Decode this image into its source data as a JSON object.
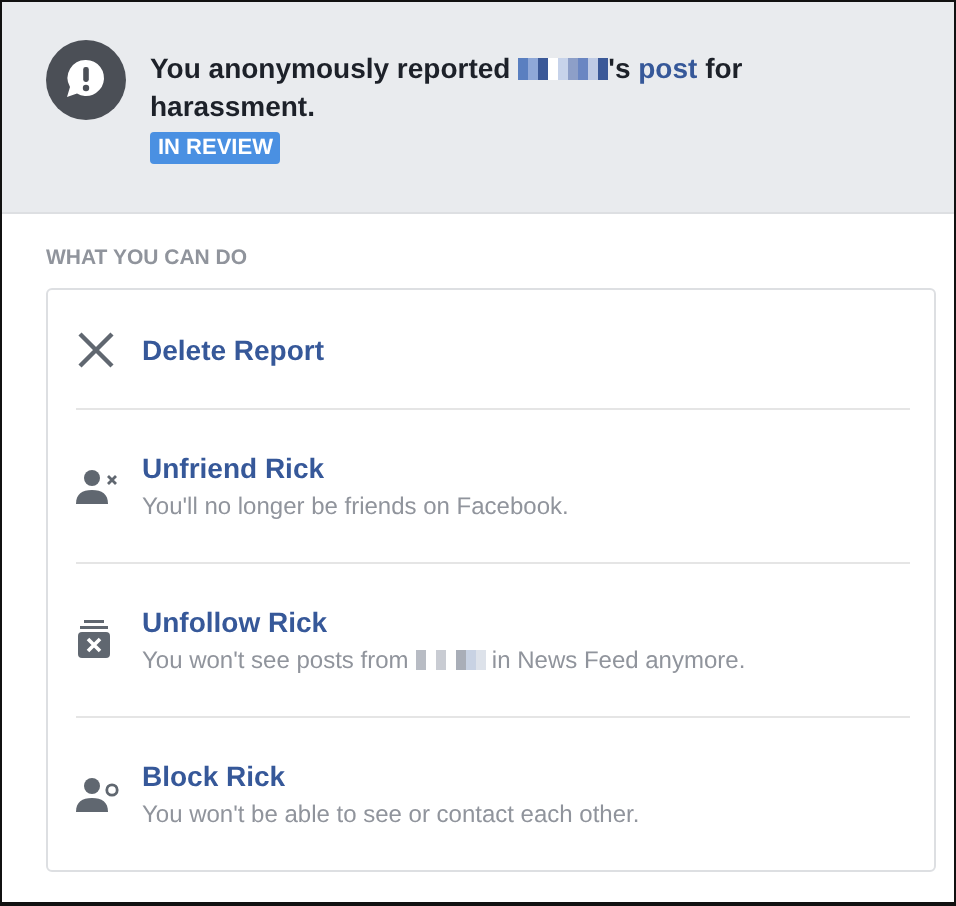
{
  "report": {
    "message": [
      {
        "kind": "text",
        "text": "You anonymously reported "
      },
      {
        "kind": "redacted"
      },
      {
        "kind": "text",
        "text": "'s "
      },
      {
        "kind": "link",
        "text": "post"
      },
      {
        "kind": "text",
        "text": " for harassment."
      }
    ],
    "badge": "IN REVIEW"
  },
  "section_title": "WHAT YOU CAN DO",
  "actions": [
    {
      "kind": "delete",
      "title": "Delete Report"
    },
    {
      "kind": "unfriend",
      "title": "Unfriend Rick",
      "description": [
        {
          "kind": "text",
          "text": "You'll no longer be friends on Facebook."
        }
      ]
    },
    {
      "kind": "unfollow",
      "title": "Unfollow Rick",
      "description": [
        {
          "kind": "text",
          "text": "You won't see posts from "
        },
        {
          "kind": "redacted"
        },
        {
          "kind": "text",
          "text": " in News Feed anymore."
        }
      ]
    },
    {
      "kind": "block",
      "title": "Block Rick",
      "description": [
        {
          "kind": "text",
          "text": "You won't be able to see or contact each other."
        }
      ]
    }
  ]
}
